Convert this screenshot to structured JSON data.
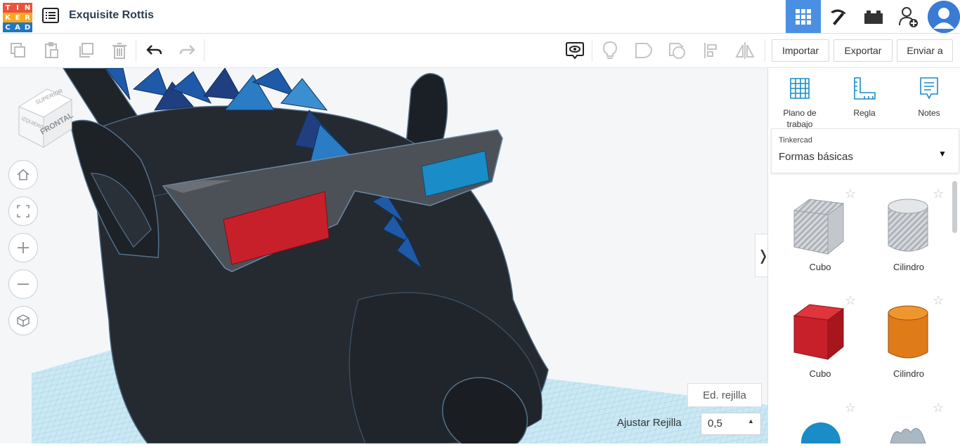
{
  "app": {
    "logo_letters": [
      "T",
      "I",
      "N",
      "K",
      "E",
      "R",
      "C",
      "A",
      "D"
    ],
    "logo_colors": [
      "#e8543f",
      "#e8543f",
      "#e8543f",
      "#f7a823",
      "#f7a823",
      "#f7a823",
      "#1f77c4",
      "#1f77c4",
      "#1f77c4"
    ],
    "project_title": "Exquisite Rottis",
    "accent": "#4a90e2"
  },
  "header": {
    "buttons": [
      "3d-design-view",
      "build-pickaxe",
      "bricks",
      "add-user",
      "avatar"
    ]
  },
  "toolbar": {
    "import_label": "Importar",
    "export_label": "Exportar",
    "send_label": "Enviar a"
  },
  "viewcube": {
    "top": "SUPERIOR",
    "front": "FRONTAL",
    "side": "IZQUIERDA"
  },
  "workspace": {
    "edit_grid_label": "Ed. rejilla",
    "snap_label": "Ajustar Rejilla",
    "snap_value": "0,5"
  },
  "panel": {
    "tools": [
      {
        "label": "Plano de trabajo"
      },
      {
        "label": "Regla"
      },
      {
        "label": "Notes"
      }
    ],
    "library_source": "Tinkercad",
    "library_value": "Formas básicas",
    "shapes": [
      {
        "label": "Cubo",
        "color": "#c8cbd0"
      },
      {
        "label": "Cilindro",
        "color": "#c8cbd0"
      },
      {
        "label": "Cubo",
        "color": "#c8202a"
      },
      {
        "label": "Cilindro",
        "color": "#e07b1a"
      }
    ]
  }
}
